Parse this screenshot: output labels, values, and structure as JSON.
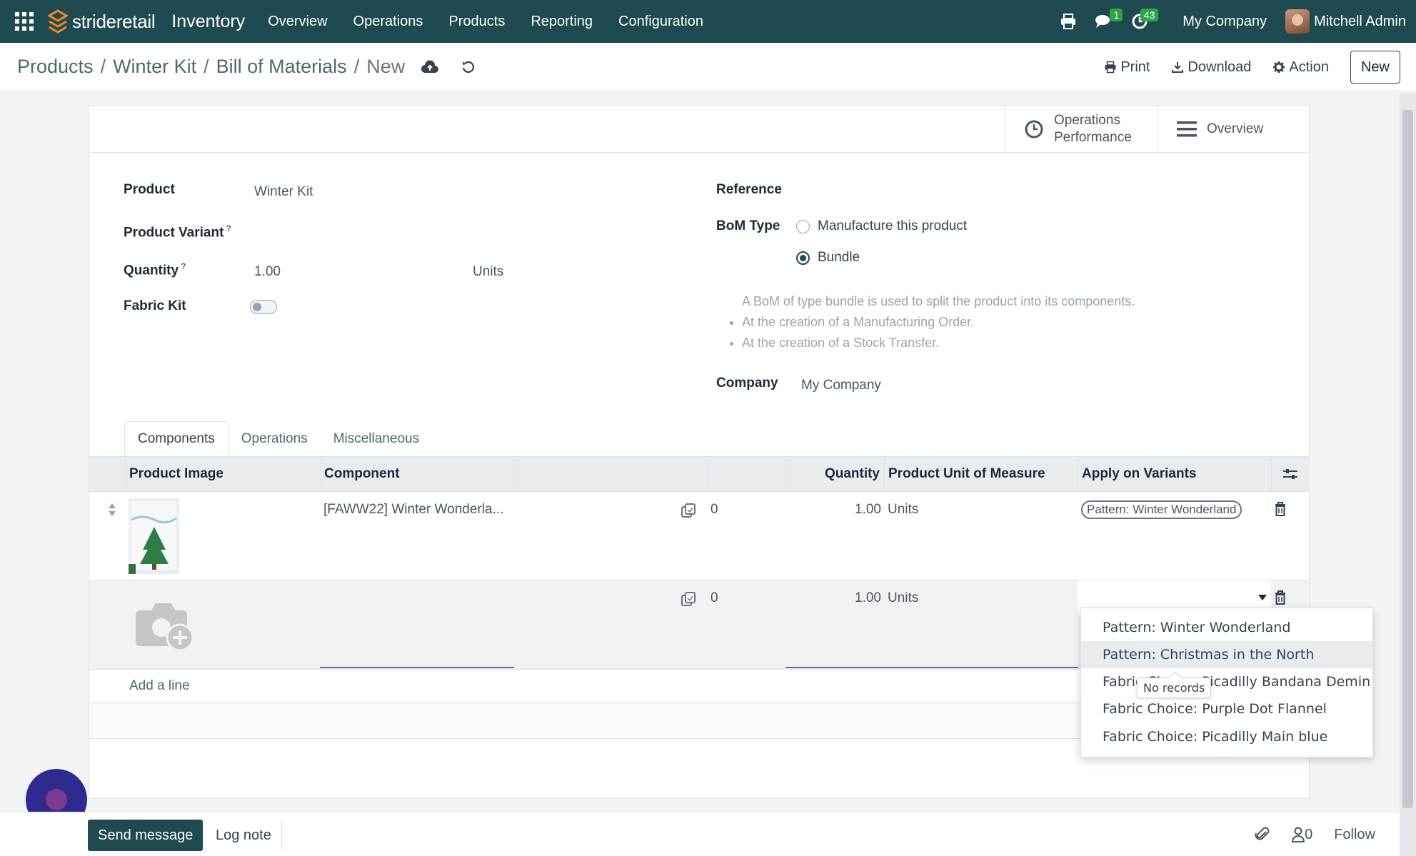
{
  "brand": {
    "name": "strideretail",
    "app": "Inventory"
  },
  "nav": {
    "menu": [
      "Overview",
      "Operations",
      "Products",
      "Reporting",
      "Configuration"
    ],
    "messages_badge": "1",
    "activities_badge": "43",
    "company": "My Company",
    "user": "Mitchell Admin"
  },
  "breadcrumb": {
    "items": [
      "Products",
      "Winter Kit",
      "Bill of Materials"
    ],
    "current": "New"
  },
  "actions": {
    "print": "Print",
    "download": "Download",
    "action": "Action",
    "new": "New"
  },
  "stat_buttons": {
    "performance_line1": "Operations",
    "performance_line2": "Performance",
    "overview": "Overview"
  },
  "form": {
    "product_label": "Product",
    "product_value": "Winter Kit",
    "variant_label": "Product Variant",
    "quantity_label": "Quantity",
    "quantity_value": "1.00",
    "quantity_uom": "Units",
    "fabric_kit_label": "Fabric Kit",
    "reference_label": "Reference",
    "bom_type_label": "BoM Type",
    "bom_type_options": [
      "Manufacture this product",
      "Bundle"
    ],
    "bom_type_selected": "Bundle",
    "help_intro": "A BoM of type bundle is used to split the product into its components.",
    "help_items": [
      "At the creation of a Manufacturing Order.",
      "At the creation of a Stock Transfer."
    ],
    "company_label": "Company",
    "company_value": "My Company",
    "help_mark": "?"
  },
  "tabs": [
    "Components",
    "Operations",
    "Miscellaneous"
  ],
  "table": {
    "columns": [
      "Product Image",
      "Component",
      "Quantity",
      "Product Unit of Measure",
      "Apply on Variants"
    ],
    "rows": [
      {
        "component": "[FAWW22] Winter Wonderla...",
        "count": "0",
        "quantity": "1.00",
        "uom": "Units",
        "variant_tag": "Pattern: Winter Wonderland"
      },
      {
        "component": "",
        "count": "0",
        "quantity": "1.00",
        "uom": "Units",
        "variant_tag": ""
      }
    ],
    "add_line": "Add a line"
  },
  "variant_dropdown": {
    "options": [
      "Pattern: Winter Wonderland",
      "Pattern: Christmas in the North",
      "Fabric Choice: Picadilly Bandana Demin",
      "Fabric Choice: Purple Dot Flannel",
      "Fabric Choice: Picadilly Main blue"
    ],
    "highlighted_index": 1,
    "tooltip": "No records"
  },
  "chatter": {
    "send": "Send message",
    "log": "Log note",
    "followers": "0",
    "follow": "Follow"
  },
  "colors": {
    "nav_bg": "#1f4a4f",
    "badge": "#28a745",
    "accent": "#1f4a4f"
  }
}
